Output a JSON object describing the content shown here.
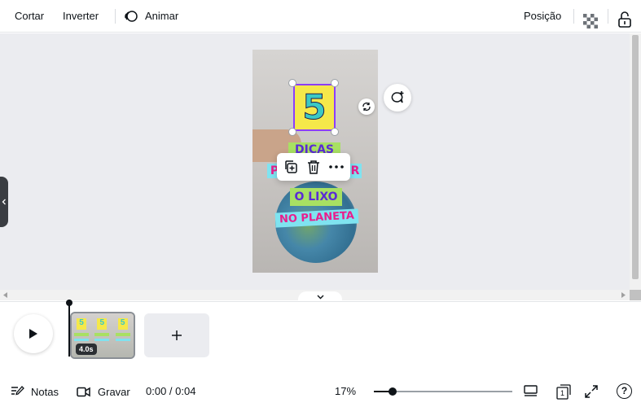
{
  "toolbar": {
    "crop_label": "Cortar",
    "flip_label": "Inverter",
    "animate_label": "Animar",
    "position_label": "Posição"
  },
  "design": {
    "number": "5",
    "line1": "DICAS",
    "line2_left": "P",
    "line2_right": "R",
    "line3": "O LIXO",
    "line4": "NO PLANETA"
  },
  "timeline": {
    "clip_duration": "4.0s",
    "thumb_number": "5"
  },
  "bottom": {
    "notes_label": "Notas",
    "record_label": "Gravar",
    "time": "0:00 / 0:04",
    "zoom": "17%",
    "page_count": "1",
    "help": "?",
    "zoom_level": 0.17
  },
  "colors": {
    "accent": "#8b3dff",
    "yellow": "#f5e84a",
    "green": "#a8e063",
    "cyan": "#7fe3f0",
    "pink": "#e91e8c",
    "purple": "#5b2bd6"
  }
}
